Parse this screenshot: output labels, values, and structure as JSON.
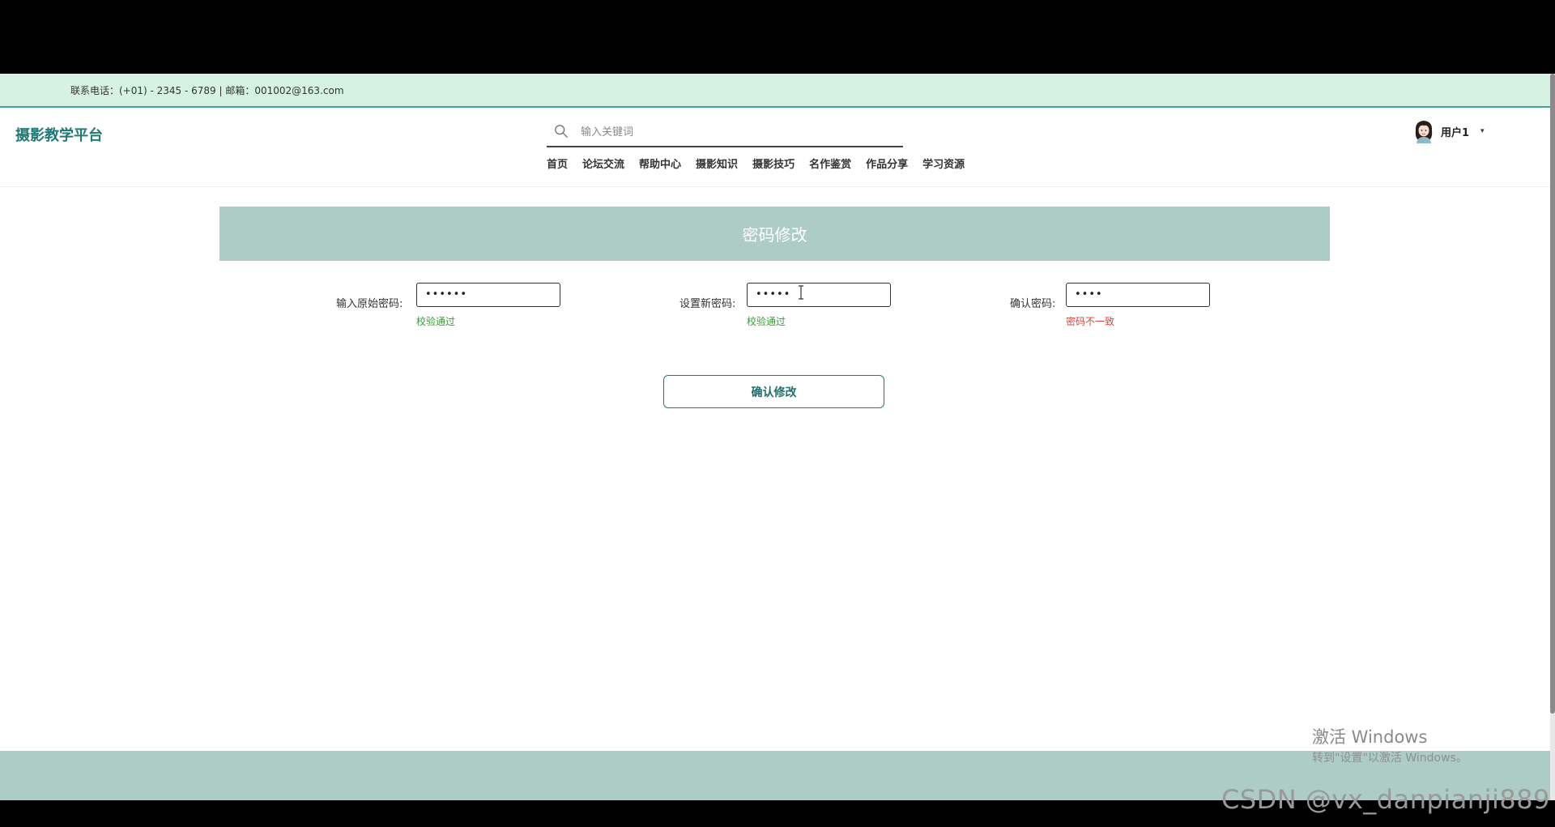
{
  "topbar": {
    "contact": "联系电话：(+01) - 2345 - 6789 | 邮箱：001002@163.com"
  },
  "header": {
    "logo": "摄影教学平台",
    "search_placeholder": "输入关键词",
    "user_name": "用户1",
    "caret": "▾"
  },
  "nav": [
    "首页",
    "论坛交流",
    "帮助中心",
    "摄影知识",
    "摄影技巧",
    "名作鉴赏",
    "作品分享",
    "学习资源"
  ],
  "banner": {
    "title": "密码修改"
  },
  "form": {
    "old": {
      "label": "输入原始密码:",
      "value": "••••••",
      "hint": "校验通过"
    },
    "new": {
      "label": "设置新密码:",
      "value": "•••••",
      "hint": "校验通过"
    },
    "confirm": {
      "label": "确认密码:",
      "value": "••••",
      "hint": "密码不一致"
    },
    "submit": "确认修改"
  },
  "watermark": {
    "line1": "激活 Windows",
    "line2": "转到\"设置\"以激活 Windows。"
  },
  "overlay": "CSDN @vx_danpianji889",
  "colors": {
    "accent": "#1f7a74",
    "banner": "#adccc5",
    "topbar": "#d6f2e2",
    "ok": "#3a9a3a",
    "error": "#d9453a"
  }
}
